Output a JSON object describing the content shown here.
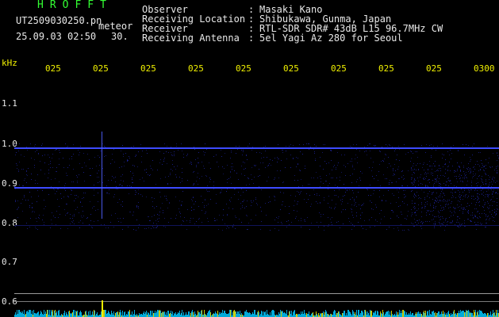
{
  "header": {
    "brand": "HROFFT",
    "file_name": "UT2509030250.pn",
    "meteor_label": "meteor",
    "datetime": "25.09.03 02:50",
    "seconds": "30.",
    "rows": [
      {
        "label": "Observer",
        "value": "Masaki Kano"
      },
      {
        "label": "Receiving Location",
        "value": "Shibukawa, Gunma, Japan"
      },
      {
        "label": "Receiver",
        "value": "RTL-SDR SDR# 43dB L15 96.7MHz CW"
      },
      {
        "label": "Receiving Antenna",
        "value": "5el Yagi Az 280 for Seoul"
      }
    ]
  },
  "axes": {
    "y_unit": "kHz",
    "y_ticks": [
      "1.1",
      "1.0",
      "0.9",
      "0.8",
      "0.7",
      "0.6"
    ],
    "x_ticks": [
      "025",
      "025",
      "025",
      "025",
      "025",
      "025",
      "025",
      "025",
      "025",
      "0300"
    ]
  },
  "colors": {
    "text": "#e8e8e8",
    "brand": "#33ff33",
    "tick": "#f0f000",
    "signal": "#3d4bff",
    "noise": "#1a1f8a",
    "floor": "#00c8ff"
  }
}
